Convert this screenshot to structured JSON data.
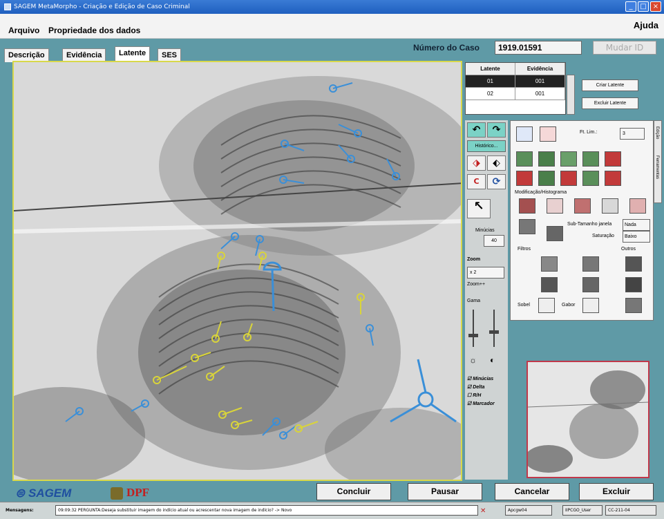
{
  "window": {
    "title": "SAGEM MetaMorpho - Criação e Edição de Caso Criminal",
    "controls": [
      "minimize",
      "maximize",
      "close"
    ]
  },
  "menu": {
    "file": "Arquivo",
    "properties": "Propriedade dos dados",
    "help": "Ajuda"
  },
  "tabs": [
    {
      "label": "Descrição",
      "active": false
    },
    {
      "label": "Evidência",
      "active": false
    },
    {
      "label": "Latente",
      "active": true
    },
    {
      "label": "SES",
      "active": false
    }
  ],
  "case": {
    "label": "Número do Caso",
    "value": "1919.01591",
    "change_id": "Mudar ID"
  },
  "latent_table": {
    "headers": [
      "Latente",
      "Evidência"
    ],
    "rows": [
      [
        "01",
        "001"
      ],
      [
        "02",
        "001"
      ]
    ]
  },
  "latent_buttons": {
    "create": "Criar Latente",
    "delete": "Excluir Latente"
  },
  "tools": {
    "history": "Histórico...",
    "minutiae_label": "Minúcias",
    "minutiae_count": "40",
    "zoom_label": "Zoom",
    "zoom_value": "x 2",
    "zoom_plus": "Zoom++",
    "gamma_label": "Gama"
  },
  "enhancement": {
    "ft_label": "Ft. Lim.:",
    "ft_value": "3",
    "modification_label": "Modificação/Histograma",
    "window_label": "Sub-Tamanho janela",
    "window_value": "Nada",
    "saturation_label": "Saturação",
    "saturation_value": "Baixo",
    "filters_label": "Filtros",
    "others_label": "Outros",
    "sobel_label": "Sobel",
    "gabor_label": "Gabor",
    "side_tabs": [
      "Edição",
      "Ferramentas"
    ]
  },
  "checkboxes": [
    {
      "label": "Minúcias",
      "checked": true
    },
    {
      "label": "Delta",
      "checked": true
    },
    {
      "label": "R/H",
      "checked": false
    },
    {
      "label": "Marcador",
      "checked": true
    }
  ],
  "logos": {
    "sagem": "SAGEM",
    "dpf": "DPF"
  },
  "actions": {
    "conclude": "Concluir",
    "pause": "Pausar",
    "cancel": "Cancelar",
    "delete": "Excluir"
  },
  "status": {
    "label": "Mensagens:",
    "message": "09:09:32 PERGUNTA:Deseja substituir imagem do indício atual ou acrescentar nova imagem de indício? -> Novo",
    "user": "Apcgw04",
    "station": "IIPCGO_User",
    "code": "CC-211-04"
  },
  "colors": {
    "background": "#5f9aa6",
    "minutia_blue": "#3a8fd8",
    "minutia_yellow": "#d9d43a",
    "preview_border": "#c0384a"
  }
}
